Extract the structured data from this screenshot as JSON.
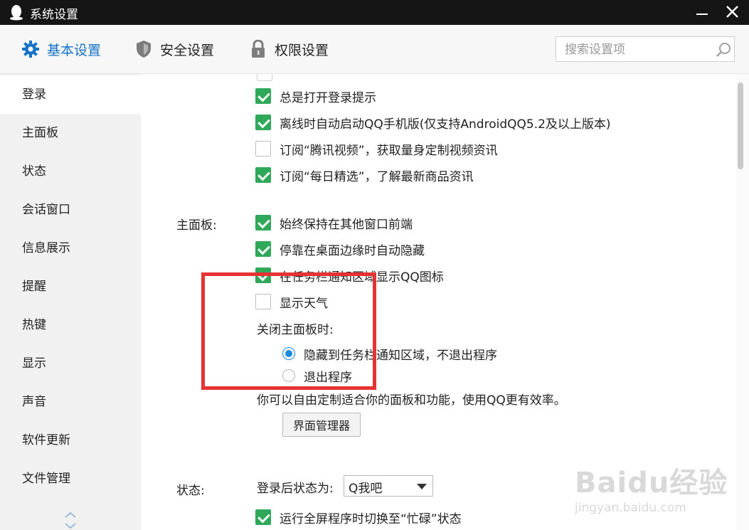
{
  "window": {
    "title": "系统设置"
  },
  "tabs": [
    {
      "label": "基本设置",
      "icon": "gear-icon",
      "active": true
    },
    {
      "label": "安全设置",
      "icon": "shield-icon",
      "active": false
    },
    {
      "label": "权限设置",
      "icon": "lock-icon",
      "active": false
    }
  ],
  "search": {
    "placeholder": "搜索设置项"
  },
  "sidebar": {
    "items": [
      {
        "label": "登录"
      },
      {
        "label": "主面板"
      },
      {
        "label": "状态"
      },
      {
        "label": "会话窗口"
      },
      {
        "label": "信息展示"
      },
      {
        "label": "提醒"
      },
      {
        "label": "热键"
      },
      {
        "label": "显示"
      },
      {
        "label": "声音"
      },
      {
        "label": "软件更新"
      },
      {
        "label": "文件管理"
      }
    ]
  },
  "login": {
    "options": [
      {
        "label": "总是打开登录提示",
        "checked": true
      },
      {
        "label": "离线时自动启动QQ手机版(仅支持AndroidQQ5.2及以上版本)",
        "checked": true
      },
      {
        "label": "订阅“腾讯视频”，获取量身定制视频资讯",
        "checked": false
      },
      {
        "label": "订阅“每日精选”，了解最新商品资讯",
        "checked": true
      }
    ]
  },
  "mainpanel": {
    "label": "主面板:",
    "options": [
      {
        "label": "始终保持在其他窗口前端",
        "checked": true
      },
      {
        "label": "停靠在桌面边缘时自动隐藏",
        "checked": true
      },
      {
        "label": "在任务栏通知区域显示QQ图标",
        "checked": true
      },
      {
        "label": "显示天气",
        "checked": false
      }
    ],
    "close_label": "关闭主面板时:",
    "close_options": [
      {
        "label": "隐藏到任务栏通知区域，不退出程序",
        "selected": true
      },
      {
        "label": "退出程序",
        "selected": false
      }
    ],
    "tip": "你可以自由定制适合你的面板和功能，使用QQ更有效率。",
    "manager_button": "界面管理器"
  },
  "status": {
    "label": "状态:",
    "login_status_label": "登录后状态为:",
    "login_status_value": "Q我吧",
    "fullscreen_option": {
      "label": "运行全屏程序时切换至“忙碌”状态",
      "checked": true
    }
  },
  "watermark": {
    "text": "Baidu经验",
    "sub": "jingyan.baidu.com"
  }
}
